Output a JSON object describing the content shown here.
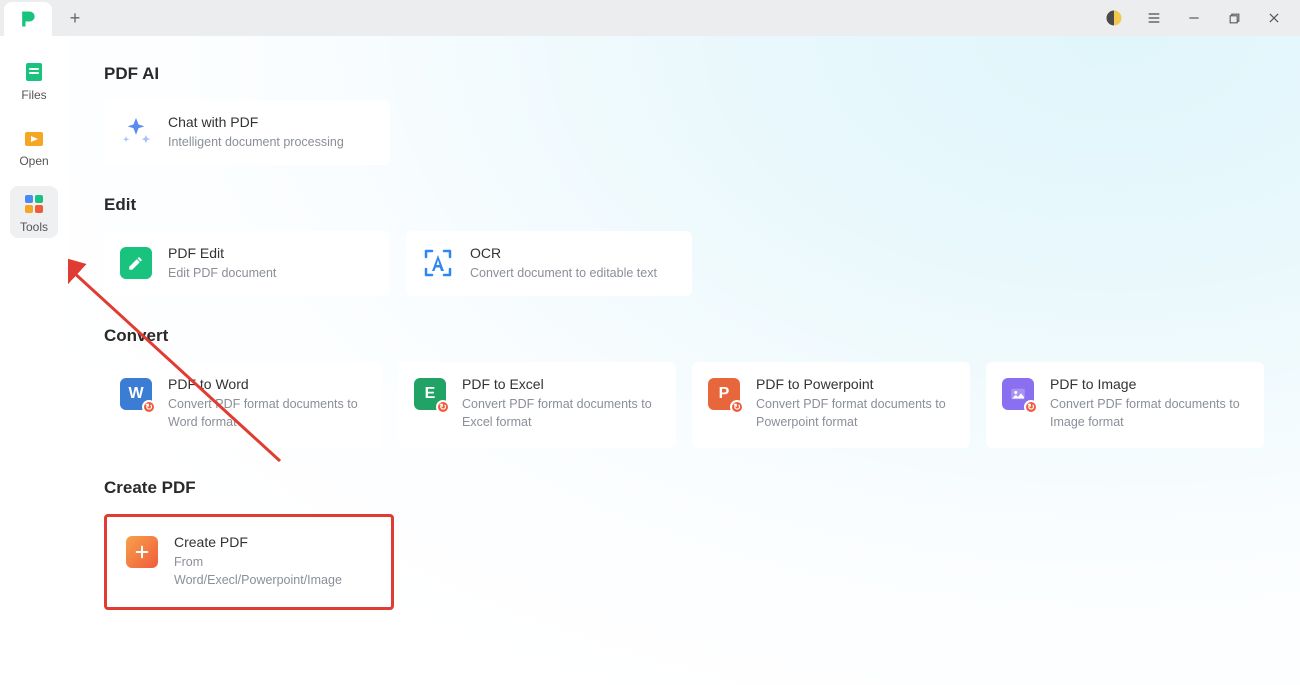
{
  "titlebar": {
    "plus_label": "+"
  },
  "sidebar": {
    "items": [
      {
        "label": "Files"
      },
      {
        "label": "Open"
      },
      {
        "label": "Tools"
      }
    ]
  },
  "sections": {
    "pdf_ai": {
      "title": "PDF AI",
      "cards": [
        {
          "title": "Chat with PDF",
          "desc": "Intelligent document processing"
        }
      ]
    },
    "edit": {
      "title": "Edit",
      "cards": [
        {
          "title": "PDF Edit",
          "desc": "Edit PDF document"
        },
        {
          "title": "OCR",
          "desc": "Convert document to editable text"
        }
      ]
    },
    "convert": {
      "title": "Convert",
      "cards": [
        {
          "title": "PDF to Word",
          "desc": "Convert PDF format documents to Word format"
        },
        {
          "title": "PDF to Excel",
          "desc": "Convert PDF format documents to Excel format"
        },
        {
          "title": "PDF to Powerpoint",
          "desc": "Convert PDF format documents to Powerpoint format"
        },
        {
          "title": "PDF to Image",
          "desc": "Convert PDF format documents to Image format"
        }
      ]
    },
    "create": {
      "title": "Create PDF",
      "cards": [
        {
          "title": "Create PDF",
          "desc": "From Word/Execl/Powerpoint/Image"
        }
      ]
    }
  }
}
